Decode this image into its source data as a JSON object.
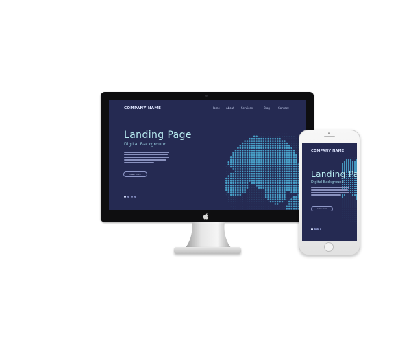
{
  "colors": {
    "site_background": "#252a52",
    "heading": "#b8ebf0",
    "subheading": "#9fd7e6",
    "globe_dots": "#4aa7cf",
    "frame": "#0e0e10"
  },
  "desktop": {
    "brand": "COMPANY NAME",
    "nav": [
      "Home",
      "About",
      "Services",
      "Blog",
      "Contact"
    ],
    "hero_title": "Landing Page",
    "hero_subtitle": "Digital Background",
    "button_label": "Learn more",
    "slides": 4,
    "active_slide": 1
  },
  "mobile": {
    "brand": "COMPANY NAME",
    "hero_title": "Landing Page",
    "hero_subtitle": "Digital Background",
    "button_label": "Learn more",
    "slides": 4,
    "active_slide": 1
  },
  "icons": {
    "monitor_logo": "apple-logo-icon",
    "phone_home": "home-button-icon"
  }
}
